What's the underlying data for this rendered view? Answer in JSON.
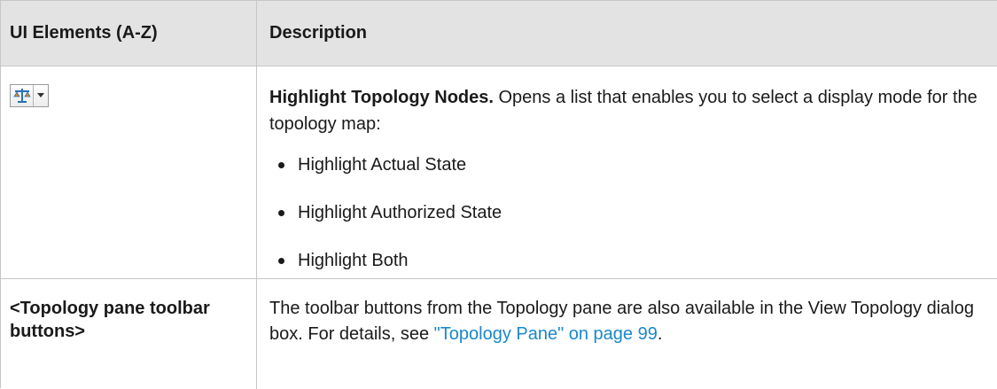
{
  "table": {
    "headers": {
      "col1": "UI Elements (A-Z)",
      "col2": "Description"
    },
    "rows": [
      {
        "element_icon": "highlight-topology-nodes-icon",
        "description_title": "Highlight Topology Nodes.",
        "description_text": " Opens a list that enables you to select a display mode for the topology map:",
        "options": [
          "Highlight Actual State",
          "Highlight Authorized State",
          "Highlight Both"
        ]
      },
      {
        "element_label": "<Topology pane toolbar buttons>",
        "description_text": "The toolbar buttons from the Topology pane are also available in the View Topology dialog box. For details, see ",
        "description_link": "\"Topology Pane\" on page 99",
        "description_end": "."
      }
    ]
  },
  "colors": {
    "header_bg": "#e3e3e3",
    "border": "#c6c6c6",
    "link": "#1a88c9",
    "icon_blue": "#2b6fb8",
    "icon_orange": "#e08a1e"
  }
}
